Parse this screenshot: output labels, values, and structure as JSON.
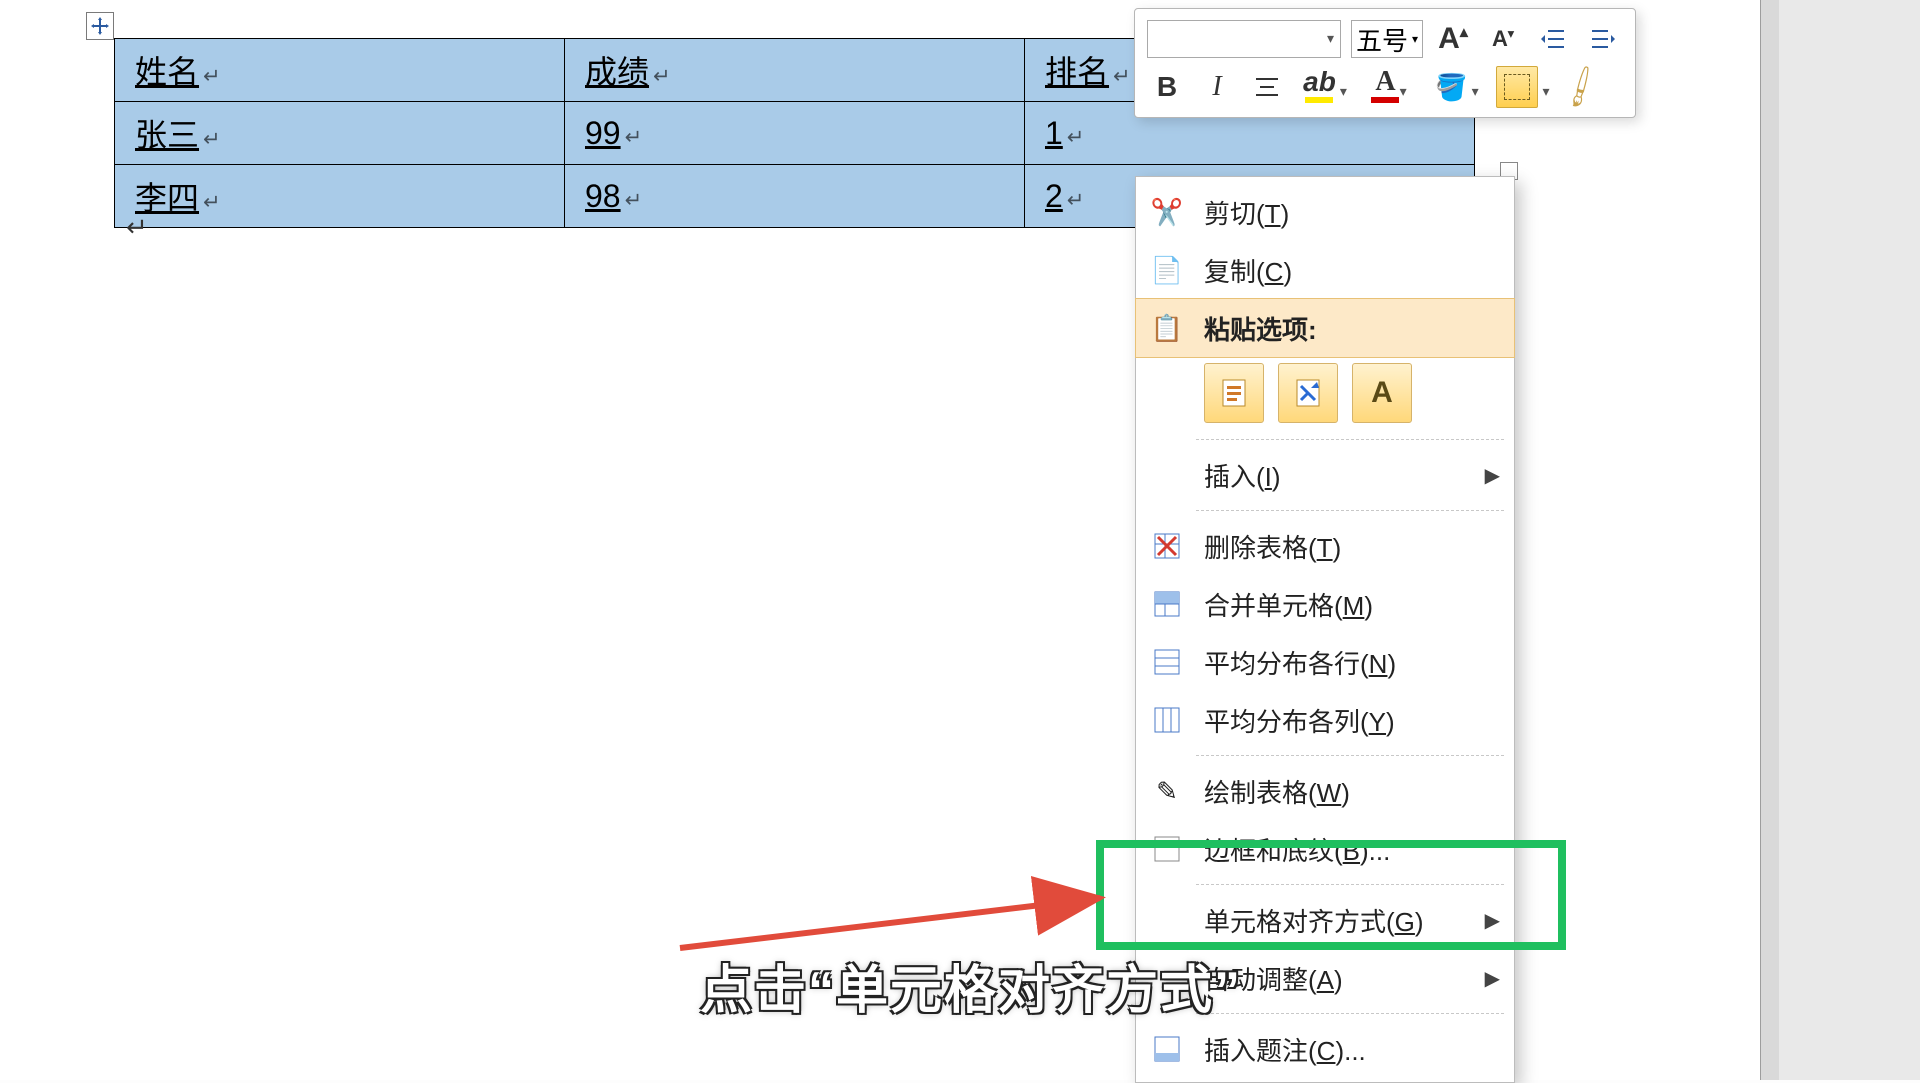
{
  "table": {
    "headers": [
      "姓名",
      "成绩",
      "排名"
    ],
    "rows": [
      [
        "张三",
        "99",
        "1"
      ],
      [
        "李四",
        "98",
        "2"
      ]
    ]
  },
  "mini_toolbar": {
    "font_name": "",
    "font_size_label": "五号",
    "bold": "B",
    "italic": "I",
    "ab_hint": "ab",
    "A": "A"
  },
  "context_menu": {
    "cut": "剪切(T)",
    "cut_u": "T",
    "copy": "复制(C)",
    "copy_u": "C",
    "paste_heading": "粘贴选项:",
    "paste_text_only": "A",
    "insert": "插入(I)",
    "insert_u": "I",
    "delete_table": "删除表格(T)",
    "delete_table_u": "T",
    "merge_cells": "合并单元格(M)",
    "merge_cells_u": "M",
    "distribute_rows": "平均分布各行(N)",
    "distribute_rows_u": "N",
    "distribute_cols": "平均分布各列(Y)",
    "distribute_cols_u": "Y",
    "draw_table": "绘制表格(W)",
    "draw_table_u": "W",
    "borders_shading": "边框和底纹(B)...",
    "borders_shading_u": "B",
    "cell_alignment": "单元格对齐方式(G)",
    "cell_alignment_u": "G",
    "autofit": "自动调整(A)",
    "autofit_u": "A",
    "insert_caption": "插入题注(C)...",
    "insert_caption_u": "C"
  },
  "annotation": {
    "caption": "点击“单元格对齐方式”",
    "highlight_color": "#1fbf5f",
    "arrow_color": "#e14b3b"
  }
}
